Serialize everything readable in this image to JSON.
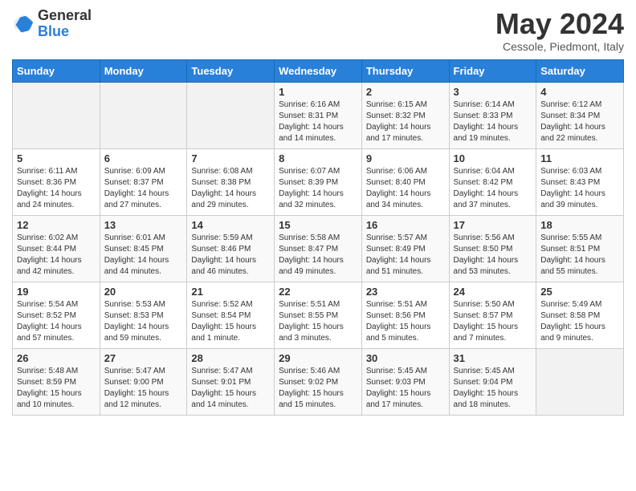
{
  "header": {
    "logo": {
      "general": "General",
      "blue": "Blue"
    },
    "title": "May 2024",
    "subtitle": "Cessole, Piedmont, Italy"
  },
  "calendar": {
    "days_of_week": [
      "Sunday",
      "Monday",
      "Tuesday",
      "Wednesday",
      "Thursday",
      "Friday",
      "Saturday"
    ],
    "weeks": [
      [
        {
          "day": "",
          "info": ""
        },
        {
          "day": "",
          "info": ""
        },
        {
          "day": "",
          "info": ""
        },
        {
          "day": "1",
          "info": "Sunrise: 6:16 AM\nSunset: 8:31 PM\nDaylight: 14 hours\nand 14 minutes."
        },
        {
          "day": "2",
          "info": "Sunrise: 6:15 AM\nSunset: 8:32 PM\nDaylight: 14 hours\nand 17 minutes."
        },
        {
          "day": "3",
          "info": "Sunrise: 6:14 AM\nSunset: 8:33 PM\nDaylight: 14 hours\nand 19 minutes."
        },
        {
          "day": "4",
          "info": "Sunrise: 6:12 AM\nSunset: 8:34 PM\nDaylight: 14 hours\nand 22 minutes."
        }
      ],
      [
        {
          "day": "5",
          "info": "Sunrise: 6:11 AM\nSunset: 8:36 PM\nDaylight: 14 hours\nand 24 minutes."
        },
        {
          "day": "6",
          "info": "Sunrise: 6:09 AM\nSunset: 8:37 PM\nDaylight: 14 hours\nand 27 minutes."
        },
        {
          "day": "7",
          "info": "Sunrise: 6:08 AM\nSunset: 8:38 PM\nDaylight: 14 hours\nand 29 minutes."
        },
        {
          "day": "8",
          "info": "Sunrise: 6:07 AM\nSunset: 8:39 PM\nDaylight: 14 hours\nand 32 minutes."
        },
        {
          "day": "9",
          "info": "Sunrise: 6:06 AM\nSunset: 8:40 PM\nDaylight: 14 hours\nand 34 minutes."
        },
        {
          "day": "10",
          "info": "Sunrise: 6:04 AM\nSunset: 8:42 PM\nDaylight: 14 hours\nand 37 minutes."
        },
        {
          "day": "11",
          "info": "Sunrise: 6:03 AM\nSunset: 8:43 PM\nDaylight: 14 hours\nand 39 minutes."
        }
      ],
      [
        {
          "day": "12",
          "info": "Sunrise: 6:02 AM\nSunset: 8:44 PM\nDaylight: 14 hours\nand 42 minutes."
        },
        {
          "day": "13",
          "info": "Sunrise: 6:01 AM\nSunset: 8:45 PM\nDaylight: 14 hours\nand 44 minutes."
        },
        {
          "day": "14",
          "info": "Sunrise: 5:59 AM\nSunset: 8:46 PM\nDaylight: 14 hours\nand 46 minutes."
        },
        {
          "day": "15",
          "info": "Sunrise: 5:58 AM\nSunset: 8:47 PM\nDaylight: 14 hours\nand 49 minutes."
        },
        {
          "day": "16",
          "info": "Sunrise: 5:57 AM\nSunset: 8:49 PM\nDaylight: 14 hours\nand 51 minutes."
        },
        {
          "day": "17",
          "info": "Sunrise: 5:56 AM\nSunset: 8:50 PM\nDaylight: 14 hours\nand 53 minutes."
        },
        {
          "day": "18",
          "info": "Sunrise: 5:55 AM\nSunset: 8:51 PM\nDaylight: 14 hours\nand 55 minutes."
        }
      ],
      [
        {
          "day": "19",
          "info": "Sunrise: 5:54 AM\nSunset: 8:52 PM\nDaylight: 14 hours\nand 57 minutes."
        },
        {
          "day": "20",
          "info": "Sunrise: 5:53 AM\nSunset: 8:53 PM\nDaylight: 14 hours\nand 59 minutes."
        },
        {
          "day": "21",
          "info": "Sunrise: 5:52 AM\nSunset: 8:54 PM\nDaylight: 15 hours\nand 1 minute."
        },
        {
          "day": "22",
          "info": "Sunrise: 5:51 AM\nSunset: 8:55 PM\nDaylight: 15 hours\nand 3 minutes."
        },
        {
          "day": "23",
          "info": "Sunrise: 5:51 AM\nSunset: 8:56 PM\nDaylight: 15 hours\nand 5 minutes."
        },
        {
          "day": "24",
          "info": "Sunrise: 5:50 AM\nSunset: 8:57 PM\nDaylight: 15 hours\nand 7 minutes."
        },
        {
          "day": "25",
          "info": "Sunrise: 5:49 AM\nSunset: 8:58 PM\nDaylight: 15 hours\nand 9 minutes."
        }
      ],
      [
        {
          "day": "26",
          "info": "Sunrise: 5:48 AM\nSunset: 8:59 PM\nDaylight: 15 hours\nand 10 minutes."
        },
        {
          "day": "27",
          "info": "Sunrise: 5:47 AM\nSunset: 9:00 PM\nDaylight: 15 hours\nand 12 minutes."
        },
        {
          "day": "28",
          "info": "Sunrise: 5:47 AM\nSunset: 9:01 PM\nDaylight: 15 hours\nand 14 minutes."
        },
        {
          "day": "29",
          "info": "Sunrise: 5:46 AM\nSunset: 9:02 PM\nDaylight: 15 hours\nand 15 minutes."
        },
        {
          "day": "30",
          "info": "Sunrise: 5:45 AM\nSunset: 9:03 PM\nDaylight: 15 hours\nand 17 minutes."
        },
        {
          "day": "31",
          "info": "Sunrise: 5:45 AM\nSunset: 9:04 PM\nDaylight: 15 hours\nand 18 minutes."
        },
        {
          "day": "",
          "info": ""
        }
      ]
    ]
  }
}
